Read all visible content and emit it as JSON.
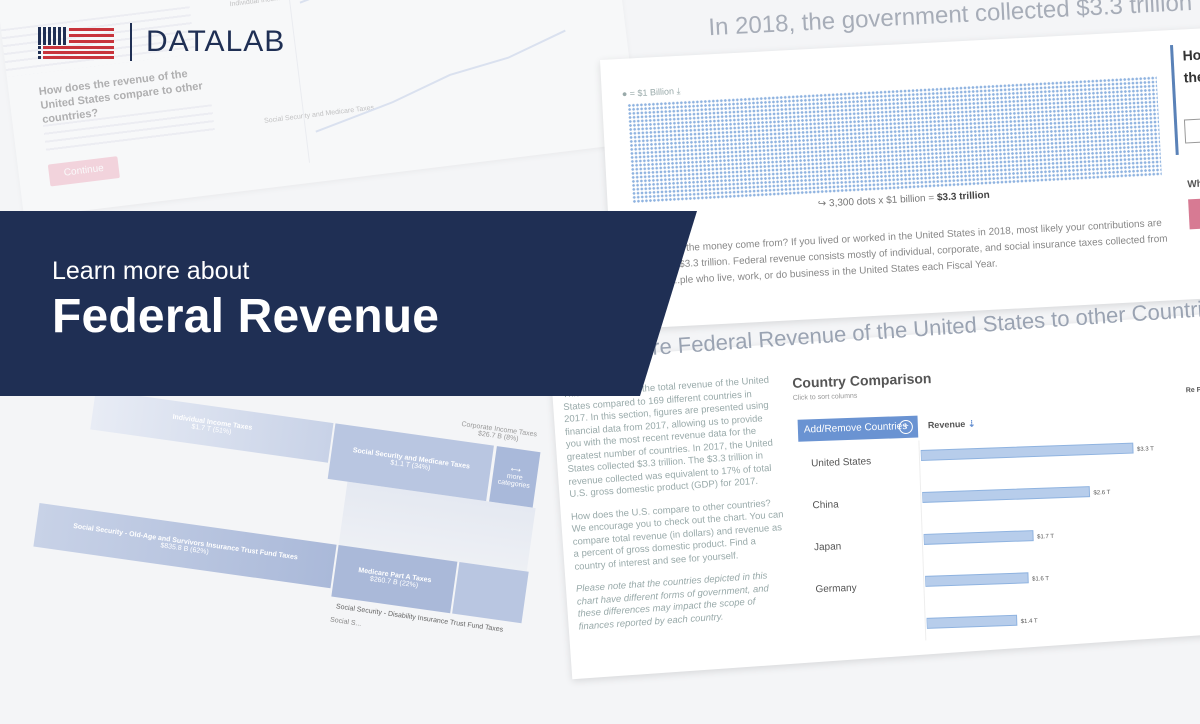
{
  "logo": {
    "part1": "DATA",
    "part2": "LAB",
    "colors": {
      "navy": "#1f2f54",
      "red": "#c8343c"
    }
  },
  "banner": {
    "line1": "Learn more about",
    "line2": "Federal Revenue",
    "color": "#1f2f54"
  },
  "panel_revenue": {
    "headline": "In 2018, the government collected $3.3 trillion",
    "legend": "= $1 Billion",
    "caption_prefix": "3,300 dots x $1 billion = ",
    "caption_total": "$3.3 trillion",
    "paragraph": "...s the money come from? If you lived or worked in the United States in 2018, most likely your contributions are ...$3.3 trillion. Federal revenue consists mostly of individual, corporate, and social insurance taxes collected from ...ple who live, work, or do business in the United States each Fiscal Year.",
    "side_question": "How con the",
    "side_question2": "Wha"
  },
  "panel_compare": {
    "headline": "...pare Federal Revenue of the United States to other Countries",
    "paragraphs": [
      "This chart outlines the total revenue of the United States compared to 169 different countries in 2017. In this section, figures are presented using financial data from 2017, allowing us to provide you with the most recent revenue data for the greatest number of countries. In 2017, the United States collected $3.3 trillion. The $3.3 trillion in revenue collected was equivalent to 17% of total U.S. gross domestic product (GDP) for 2017.",
      "How does the U.S. compare to other countries? We encourage you to check out the chart. You can compare total revenue (in dollars) and revenue as a percent of gross domestic product. Find a country of interest and see for yourself.",
      "Please note that the countries depicted in this chart have different forms of government, and these differences may impact the scope of finances reported by each country."
    ]
  },
  "country_chart": {
    "title": "Country Comparison",
    "sub": "Click to sort columns",
    "add_button": "Add/Remove Countries",
    "column": "Revenue",
    "right_col": "Re Pe"
  },
  "chart_data": {
    "type": "bar",
    "categories": [
      "United States",
      "China",
      "Japan",
      "Germany",
      ""
    ],
    "values": [
      3.3,
      2.6,
      1.7,
      1.6,
      1.4
    ],
    "value_labels": [
      "$3.3 T",
      "$2.6 T",
      "$1.7 T",
      "$1.6 T",
      "$1.4 T"
    ],
    "xlabel": "",
    "ylabel": "Revenue",
    "xlim": [
      0,
      3.5
    ]
  },
  "funnel": {
    "corporate": "Corporate Income Taxes",
    "corporate_val": "$26.7 B (8%)",
    "b1_label": "Individual Income Taxes",
    "b1_val": "$1.7 T (51%)",
    "b2_label": "Social Security and Medicare Taxes",
    "b2_val": "$1.1 T (34%)",
    "b3_label": "more categories",
    "b4_label": "Social Security - Old-Age and Survivors Insurance Trust Fund Taxes",
    "b4_val": "$835.8 B (62%)",
    "b5_label": "Medicare Part A Taxes",
    "b5_val": "$260.7 B (22%)",
    "ssdi": "Social Security - Disability Insurance Trust Fund Taxes",
    "soc": "Social S..."
  },
  "bg_chart": {
    "question": "How does the revenue of the United States compare to other countries?",
    "button": "Continue",
    "label1": "Individual Income Taxes",
    "label2": "Social Security and Medicare Taxes"
  }
}
